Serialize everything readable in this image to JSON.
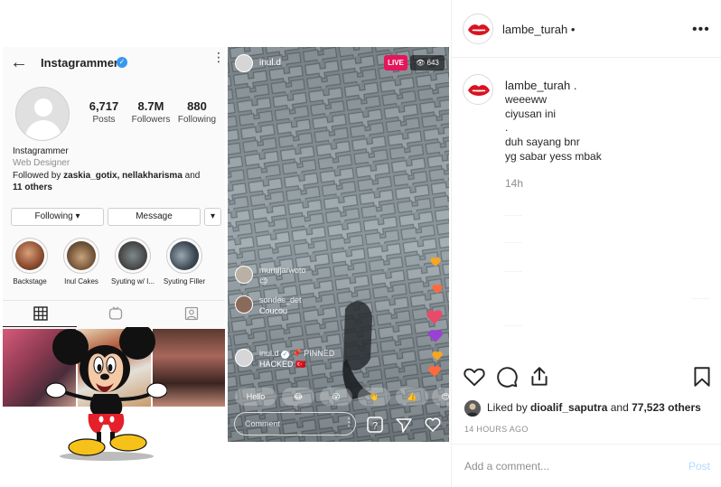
{
  "profile": {
    "title": "Instagrammer",
    "posts_count": "6,717",
    "posts_label": "Posts",
    "followers_count": "8.7M",
    "followers_label": "Followers",
    "following_count": "880",
    "following_label": "Following",
    "display_name": "Instagrammer",
    "category": "Web Designer",
    "followed_by_prefix": "Followed by ",
    "followed_by_names": "zaskia_gotix, nellakharisma",
    "followed_by_and": " and",
    "followed_by_others": "11 others",
    "following_button": "Following ▾",
    "message_button": "Message",
    "dropdown_button": "▾",
    "highlights": [
      {
        "label": "Backstage",
        "color": "#b06a4a"
      },
      {
        "label": "Inul Cakes",
        "color": "#7a5a3c"
      },
      {
        "label": "Syuting w/ I...",
        "color": "#4a4a4a"
      },
      {
        "label": "Syuting Filler",
        "color": "#3d4a55"
      }
    ]
  },
  "live": {
    "host": "inul.d",
    "live_badge": "LIVE",
    "viewers": "643",
    "comments": [
      {
        "user": "murnijarwoto",
        "text": "😉"
      },
      {
        "user": "sondes_det",
        "text": "Coucou"
      }
    ],
    "pinned_user": "inul.d",
    "pinned_label": "PINNED",
    "pinned_text": "HACKED 🇹🇷",
    "reactions": [
      "Hello",
      "😂",
      "😮",
      "👋",
      "👍",
      "😍"
    ],
    "comment_placeholder": "Comment"
  },
  "sidebar": {
    "username": "lambe_turah",
    "header_dot": "•",
    "more": "•••",
    "caption_user": "lambe_turah .",
    "caption_lines": [
      "weeeww",
      "ciyusan ini",
      ".",
      "duh sayang bnr",
      "yg sabar yess mbak"
    ],
    "caption_time": "14h",
    "liked_by_prefix": "Liked by ",
    "liked_by_user": "dioalif_saputra",
    "liked_by_and": " and ",
    "liked_by_count": "77,523 others",
    "post_time": "14 HOURS AGO",
    "comment_placeholder": "Add a comment...",
    "post_button": "Post"
  },
  "colors": {
    "live_red": "#e4175b",
    "verified_blue": "#3897f0",
    "post_disabled": "#b3dbff",
    "lips_red": "#d9131f"
  }
}
